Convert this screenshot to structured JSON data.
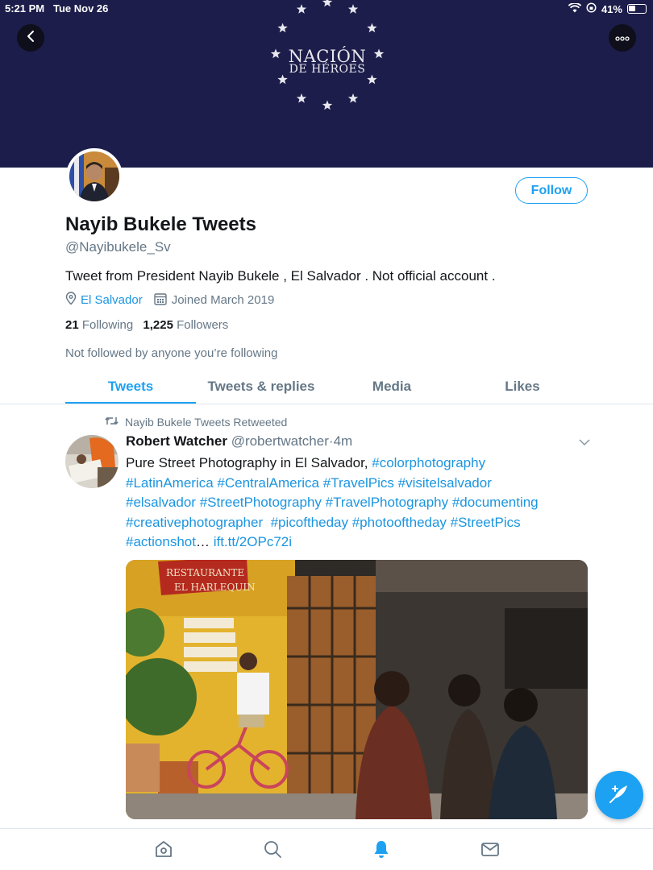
{
  "status_bar": {
    "time": "5:21 PM",
    "date": "Tue Nov 26",
    "battery": "41%"
  },
  "banner": {
    "logo_line1": "NACIÓN",
    "logo_line2": "DE HÉROES",
    "color": "#1c1d4a"
  },
  "profile": {
    "name": "Nayib Bukele Tweets",
    "handle": "@Nayibukele_Sv",
    "bio": "Tweet from President Nayib Bukele , El Salvador . Not official account .",
    "location": "El Salvador",
    "joined": "Joined March 2019",
    "following_count": "21",
    "following_label": "Following",
    "followers_count": "1,225",
    "followers_label": "Followers",
    "not_followed": "Not followed by anyone you’re following",
    "follow_label": "Follow"
  },
  "tabs": [
    {
      "label": "Tweets",
      "active": true
    },
    {
      "label": "Tweets & replies",
      "active": false
    },
    {
      "label": "Media",
      "active": false
    },
    {
      "label": "Likes",
      "active": false
    }
  ],
  "tweet": {
    "retweet_label": "Nayib Bukele Tweets Retweeted",
    "author": "Robert Watcher",
    "handle": "@robertwatcher",
    "time": "4m",
    "text_intro": "Pure Street Photography in El Salvador, ",
    "line1_tags": [
      "#colorphotography"
    ],
    "line2_tags": [
      "#LatinAmerica",
      "#CentralAmerica",
      "#TravelPics",
      "#visitelsalvador"
    ],
    "line3_tags": [
      "#elsalvador",
      "#StreetPhotography",
      "#TravelPhotography",
      "#documenting"
    ],
    "line4_tags": [
      "#creativephotographer",
      "#picoftheday",
      "#photooftheday",
      "#StreetPics"
    ],
    "last_tag": "#actionshot",
    "ellipsis": "…",
    "link": "ift.tt/2OPc72i"
  },
  "icons": {
    "back": "chevron-left-icon",
    "more": "more-icon",
    "location": "location-pin-icon",
    "calendar": "calendar-icon",
    "retweet": "retweet-icon",
    "compose": "compose-tweet-icon",
    "nav": [
      "home-icon",
      "search-icon",
      "notifications-icon",
      "messages-icon"
    ]
  },
  "colors": {
    "accent": "#1da1f2",
    "link": "#1b95e0",
    "secondary_text": "#657786"
  }
}
